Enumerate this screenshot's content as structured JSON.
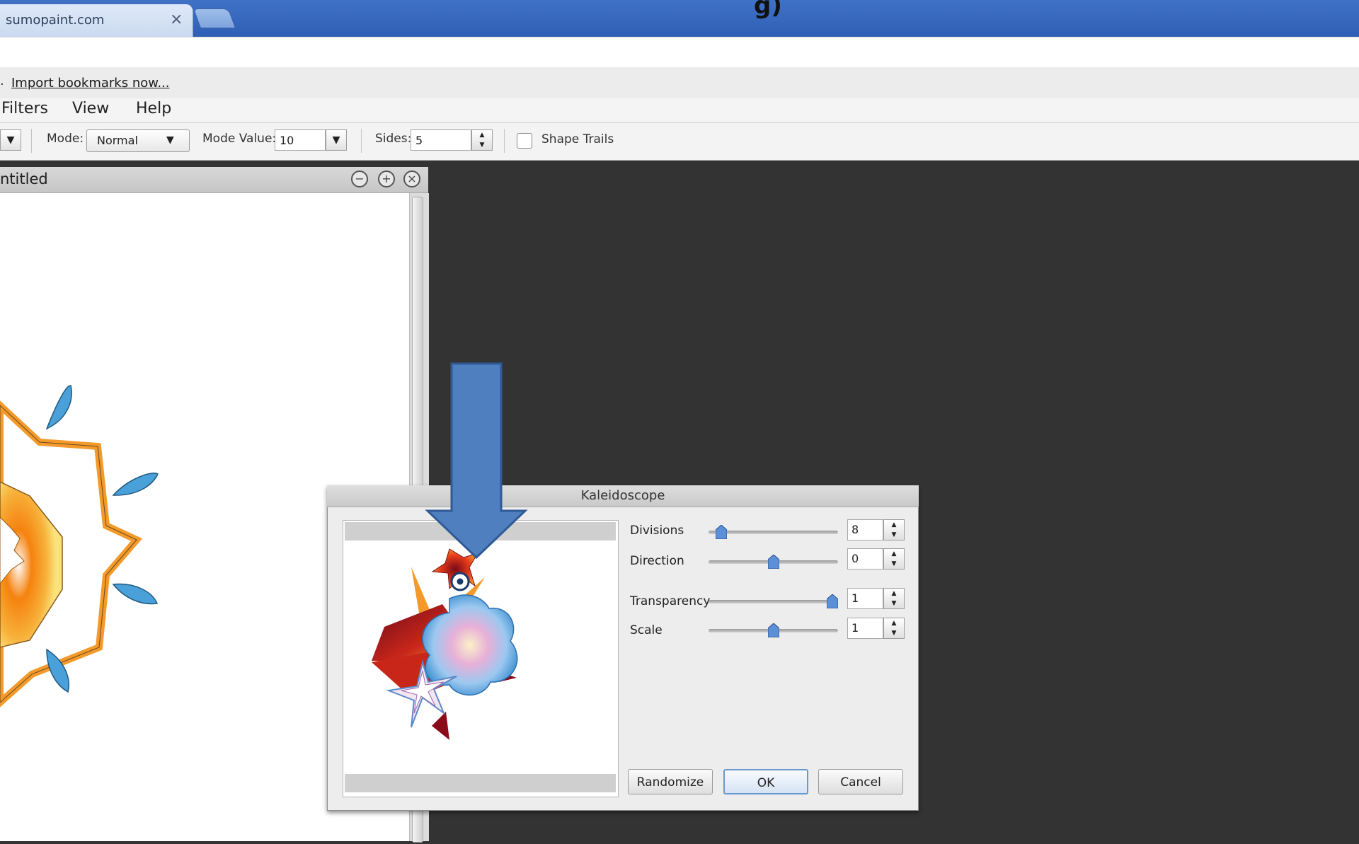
{
  "browser": {
    "tab_title": "sumopaint.com",
    "tab_close": "×",
    "page_title_fragment": "g)",
    "bookmark_prefix": ".",
    "import_bookmarks": "Import bookmarks now..."
  },
  "menu": {
    "filters": "Filters",
    "view": "View",
    "help": "Help"
  },
  "toolbar": {
    "mode_label": "Mode:",
    "mode_value": "Normal",
    "mode_value_label": "Mode Value:",
    "mode_value_value": "10",
    "sides_label": "Sides:",
    "sides_value": "5",
    "shape_trails_label": "Shape Trails",
    "shape_trails_checked": false
  },
  "document": {
    "title": "ntitled"
  },
  "dialog": {
    "title": "Kaleidoscope",
    "params": [
      {
        "label": "Divisions",
        "value": "8",
        "level": 0.06
      },
      {
        "label": "Direction",
        "value": "0",
        "level": 0.5
      },
      {
        "label": "Transparency",
        "value": "1",
        "level": 1.0
      },
      {
        "label": "Scale",
        "value": "1",
        "level": 0.5
      }
    ],
    "randomize": "Randomize",
    "ok": "OK",
    "cancel": "Cancel"
  },
  "colors": {
    "accent_blue": "#4f7fbf",
    "star_orange": "#f39a2a",
    "petal_blue": "#4aa0d8",
    "workspace": "#333333"
  }
}
